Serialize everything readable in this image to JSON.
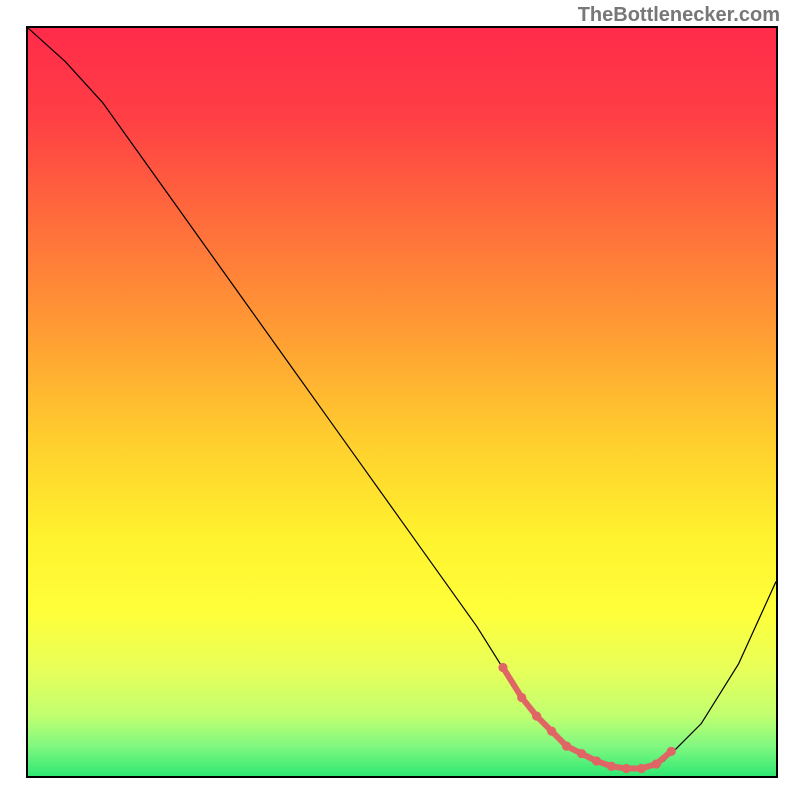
{
  "watermark": "TheBottlenecker.com",
  "chart_data": {
    "type": "line",
    "title": "",
    "xlabel": "",
    "ylabel": "",
    "xlim": [
      0,
      100
    ],
    "ylim": [
      0,
      100
    ],
    "grid": false,
    "series": [
      {
        "name": "curve",
        "color": "#000000",
        "stroke_width": 1.2,
        "x": [
          0,
          5,
          10,
          15,
          20,
          25,
          30,
          35,
          40,
          45,
          50,
          55,
          60,
          65,
          68,
          72,
          76,
          80,
          82,
          85,
          90,
          95,
          100
        ],
        "y": [
          100,
          95.5,
          90,
          83,
          76,
          69,
          62,
          55,
          48,
          41,
          34,
          27,
          20,
          12,
          8,
          4,
          2,
          1,
          1,
          2,
          7,
          15,
          26
        ]
      }
    ],
    "highlight": {
      "name": "segment",
      "color": "#e06666",
      "stroke_width": 6,
      "x": [
        63.5,
        66,
        68,
        70,
        72,
        74,
        76,
        78,
        80,
        82,
        84,
        86
      ],
      "y": [
        14.5,
        10.5,
        8,
        6,
        4,
        3,
        2,
        1.3,
        1,
        1,
        1.6,
        3.3
      ]
    },
    "gradient_stops": [
      {
        "offset": 0.0,
        "color": "#ff2b4a"
      },
      {
        "offset": 0.12,
        "color": "#ff3f45"
      },
      {
        "offset": 0.25,
        "color": "#ff6a3c"
      },
      {
        "offset": 0.4,
        "color": "#ff9a34"
      },
      {
        "offset": 0.55,
        "color": "#ffce2e"
      },
      {
        "offset": 0.68,
        "color": "#fff22e"
      },
      {
        "offset": 0.78,
        "color": "#ffff3a"
      },
      {
        "offset": 0.86,
        "color": "#e6ff5a"
      },
      {
        "offset": 0.92,
        "color": "#c0ff70"
      },
      {
        "offset": 0.96,
        "color": "#80f880"
      },
      {
        "offset": 1.0,
        "color": "#30e873"
      }
    ]
  }
}
